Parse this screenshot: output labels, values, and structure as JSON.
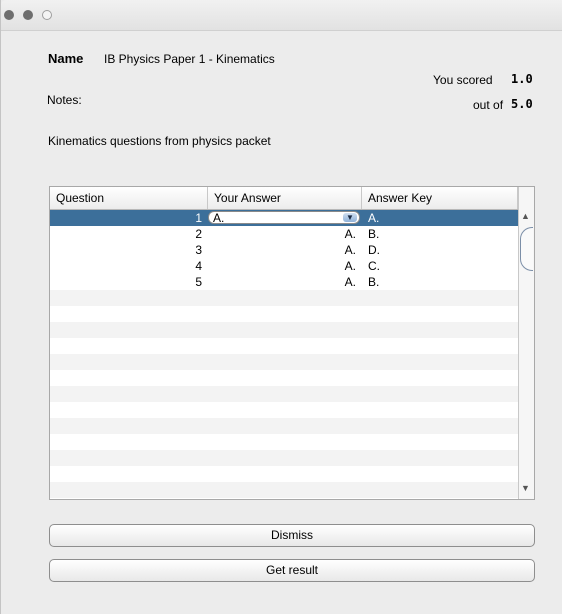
{
  "window": {
    "title_bar": {
      "close": "close-button",
      "minimize": "minimize-button",
      "maximize": "zoom-button"
    }
  },
  "header": {
    "name_label": "Name",
    "name_value": "IB Physics Paper 1 - Kinematics",
    "score_label": "You scored",
    "score_value": "1.0",
    "out_of_label": "out of",
    "out_of_value": "5.0",
    "notes_label": "Notes:",
    "notes_text": "Kinematics questions from physics packet"
  },
  "table": {
    "columns": [
      "Question",
      "Your Answer",
      "Answer Key"
    ],
    "rows": [
      {
        "question": "1",
        "answer": "A.",
        "key": "A."
      },
      {
        "question": "2",
        "answer": "A.",
        "key": "B."
      },
      {
        "question": "3",
        "answer": "A.",
        "key": "D."
      },
      {
        "question": "4",
        "answer": "A.",
        "key": "C."
      },
      {
        "question": "5",
        "answer": "A.",
        "key": "B."
      }
    ],
    "selected_row": 0,
    "combo_arrow": "▼"
  },
  "buttons": {
    "dismiss": "Dismiss",
    "get_result": "Get result"
  },
  "colors": {
    "selection": "#3c6f9a",
    "window_bg": "#ececec"
  }
}
